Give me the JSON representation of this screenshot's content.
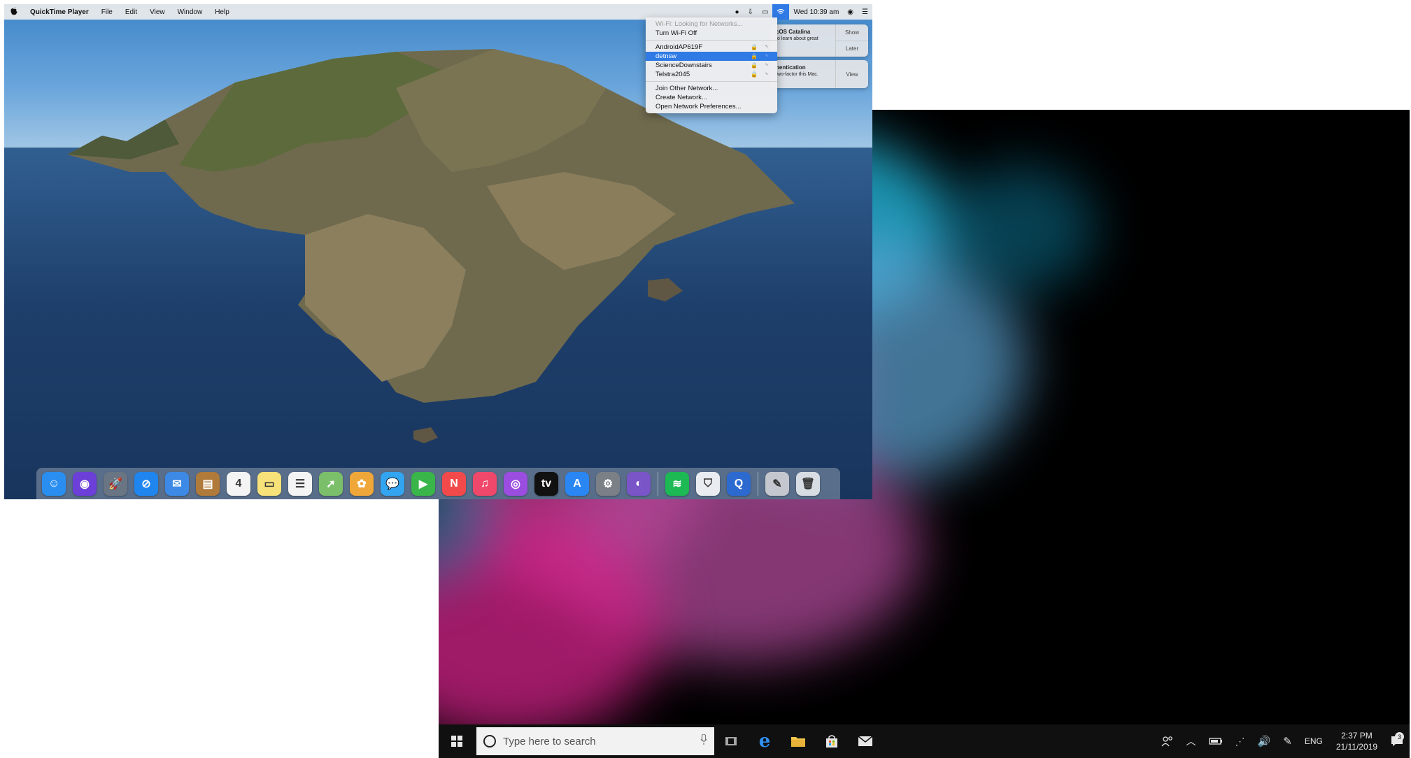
{
  "mac": {
    "menubar": {
      "apple_icon": "apple-icon",
      "app_name": "QuickTime Player",
      "menus": [
        "File",
        "Edit",
        "View",
        "Window",
        "Help"
      ],
      "clock": "Wed 10:39 am"
    },
    "wifi_menu": {
      "status": "Wi-Fi: Looking for Networks...",
      "toggle": "Turn Wi-Fi Off",
      "networks": [
        {
          "name": "AndroidAP619F",
          "locked": true,
          "selected": false
        },
        {
          "name": "detnsw",
          "locked": true,
          "selected": true
        },
        {
          "name": "ScienceDownstairs",
          "locked": true,
          "selected": false
        },
        {
          "name": "Telstra2045",
          "locked": true,
          "selected": false
        }
      ],
      "actions": [
        "Join Other Network...",
        "Create Network...",
        "Open Network Preferences..."
      ]
    },
    "notifications": [
      {
        "title": "cOS Catalina",
        "body": "to learn about great",
        "buttons": [
          "Show",
          "Later"
        ]
      },
      {
        "title": "nentication",
        "body": "two-factor this Mac.",
        "buttons": [
          "View"
        ]
      }
    ],
    "dock": {
      "apps": [
        {
          "icon": "finder-icon",
          "color": "#2a8ef0",
          "glyph": "☺"
        },
        {
          "icon": "siri-icon",
          "color": "#6b3fd8",
          "glyph": "◉"
        },
        {
          "icon": "launchpad-icon",
          "color": "#6a7583",
          "glyph": "🚀"
        },
        {
          "icon": "safari-icon",
          "color": "#1f86f0",
          "glyph": "⊘"
        },
        {
          "icon": "mail-icon",
          "color": "#3d8ae6",
          "glyph": "✉"
        },
        {
          "icon": "notefile-icon",
          "color": "#b07a3a",
          "glyph": "▤"
        },
        {
          "icon": "calendar-icon",
          "color": "#f4f4f4",
          "glyph": "4"
        },
        {
          "icon": "notes-icon",
          "color": "#f7e27a",
          "glyph": "▭"
        },
        {
          "icon": "reminders-icon",
          "color": "#f4f4f4",
          "glyph": "☰"
        },
        {
          "icon": "maps-icon",
          "color": "#7bbf6a",
          "glyph": "➚"
        },
        {
          "icon": "photos-icon",
          "color": "#f0a73a",
          "glyph": "✿"
        },
        {
          "icon": "messages-icon",
          "color": "#33a4f0",
          "glyph": "💬"
        },
        {
          "icon": "facetime-icon",
          "color": "#39b54a",
          "glyph": "▶"
        },
        {
          "icon": "news-icon",
          "color": "#f24a4a",
          "glyph": "N"
        },
        {
          "icon": "music-icon",
          "color": "#f0486a",
          "glyph": "♫"
        },
        {
          "icon": "podcasts-icon",
          "color": "#9b4de0",
          "glyph": "◎"
        },
        {
          "icon": "apple-tv-icon",
          "color": "#111111",
          "glyph": "tv"
        },
        {
          "icon": "app-store-icon",
          "color": "#2a86f3",
          "glyph": "A"
        },
        {
          "icon": "system-preferences-icon",
          "color": "#7b7f86",
          "glyph": "⚙"
        },
        {
          "icon": "self-service-icon",
          "color": "#7a55c8",
          "glyph": "◐"
        },
        {
          "icon": "spotify-icon",
          "color": "#1db954",
          "glyph": "≋"
        },
        {
          "icon": "security-shield-icon",
          "color": "#e9edf2",
          "glyph": "⛉"
        },
        {
          "icon": "quicktime-icon",
          "color": "#2d6ad0",
          "glyph": "Q"
        },
        {
          "icon": "script-editor-icon",
          "color": "#c4c8ce",
          "glyph": "✎"
        },
        {
          "icon": "trash-icon",
          "color": "#d8dde3",
          "glyph": "🗑"
        }
      ]
    }
  },
  "windows": {
    "taskbar": {
      "start_icon": "windows-start-icon",
      "search_placeholder": "Type here to search",
      "clock_time": "2:37 PM",
      "clock_date": "21/11/2019",
      "language": "ENG",
      "notification_count": "3"
    }
  }
}
